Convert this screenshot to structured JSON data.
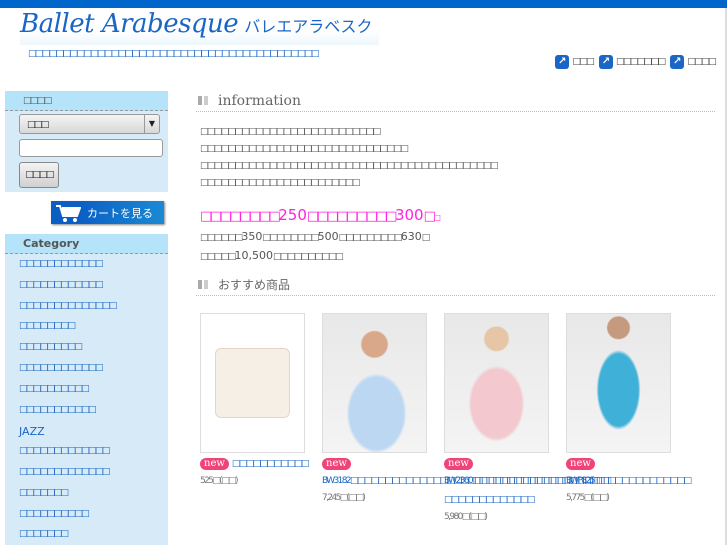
{
  "header": {
    "logo_en": "Ballet Arabesque",
    "logo_jp": "バレエアラベスク",
    "tagline": "□□□□□□□□□□□□□□□□□□□□□□□□□□□□□□□□□□□□□□□□□□",
    "links": [
      {
        "label": "□□□"
      },
      {
        "label": "□□□□□□□"
      },
      {
        "label": "□□□□"
      }
    ]
  },
  "search": {
    "title": "□□□□",
    "select_value": "□□□",
    "input_value": "",
    "button": "□□□□"
  },
  "cart_button": "カートを見る",
  "category": {
    "title": "Category",
    "items": [
      "□□□□□□□□□□□□",
      "□□□□□□□□□□□□",
      "□□□□□□□□□□□□□□",
      "□□□□□□□□",
      "□□□□□□□□□",
      "□□□□□□□□□□□□",
      "□□□□□□□□□□",
      "□□□□□□□□□□□",
      "JAZZ",
      "□□□□□□□□□□□□□",
      "□□□□□□□□□□□□□",
      "□□□□□□□",
      "□□□□□□□□□□",
      "□□□□□□□"
    ]
  },
  "information": {
    "title": "information",
    "lines": [
      "□□□□□□□□□□□□□□□□□□□□□□□□□□",
      "□□□□□□□□□□□□□□□□□□□□□□□□□□□□□□",
      "□□□□□□□□□□□□□□□□□□□□□□□□□□□□□□□□□□□□□□□□□□□",
      "□□□□□□□□□□□□□□□□□□□□□□□"
    ],
    "promo": [
      "□□□□□□□□",
      "250",
      "□□□□□□□□□",
      "300",
      "□",
      "□"
    ],
    "sub1": [
      "□□□□□□",
      "350",
      "□□□□□□□□",
      "500",
      "□□□□□□□□□",
      "630",
      "□"
    ],
    "sub2": [
      "□□□□□",
      "10,500",
      "□□□□□□□□□□"
    ]
  },
  "featured": {
    "title": "おすすめ商品",
    "new_badge": "new",
    "products": [
      {
        "title": "□□□□□□□□□□□",
        "price": "525□(□□)"
      },
      {
        "title": "BW3182□□□□□□□□□□□□□□□□□□□□□□□□□□□□□□□□□□□□",
        "price": "7,245□(□□)"
      },
      {
        "title": "BW2360□□□□□□□□□□□□□□□□□□□□ □□□□□□□□□□□□□",
        "price": "5,980□(□□)"
      },
      {
        "title": "BWP825□□□□□□□□□□□□□□",
        "price": "5,775□(□□)"
      }
    ]
  }
}
